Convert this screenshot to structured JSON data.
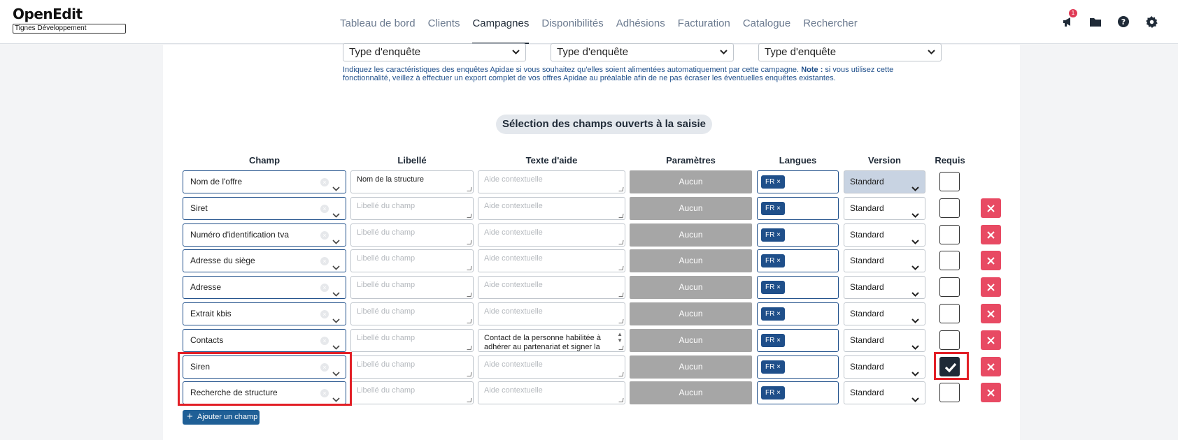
{
  "app": {
    "logo": "OpenEdit",
    "organization": "Tignes Développement"
  },
  "nav": {
    "items": [
      {
        "label": "Tableau de bord",
        "active": false
      },
      {
        "label": "Clients",
        "active": false
      },
      {
        "label": "Campagnes",
        "active": true
      },
      {
        "label": "Disponibilités",
        "active": false
      },
      {
        "label": "Adhésions",
        "active": false
      },
      {
        "label": "Facturation",
        "active": false
      },
      {
        "label": "Catalogue",
        "active": false
      },
      {
        "label": "Rechercher",
        "active": false
      }
    ],
    "notification_count": "1",
    "icons": [
      "megaphone-icon",
      "folder-icon",
      "help-icon",
      "settings-icon"
    ]
  },
  "enquetes": {
    "selects": [
      "Type d'enquête",
      "Type d'enquête",
      "Type d'enquête"
    ],
    "help_text": "Indiquez les caractéristiques des enquêtes Apidae si vous souhaitez qu'elles soient alimentées automatiquement par cette campagne.",
    "note_label": "Note :",
    "note_text": "si vous utilisez cette fonctionnalité, veillez à effectuer un export complet de vos offres Apidae au préalable afin de ne pas écraser les éventuelles enquêtes existantes."
  },
  "section": {
    "title": "Sélection des champs ouverts à la saisie"
  },
  "table": {
    "headers": {
      "champ": "Champ",
      "libelle": "Libellé",
      "aide": "Texte d'aide",
      "params": "Paramètres",
      "langues": "Langues",
      "version": "Version",
      "requis": "Requis"
    },
    "libelle_placeholder": "Libellé du champ",
    "aide_placeholder": "Aide contextuelle",
    "params_label": "Aucun",
    "lang_tag": "FR",
    "version_value": "Standard",
    "rows": [
      {
        "champ": "Nom de l'offre",
        "libelle": "Nom de la structure",
        "aide": "",
        "required": false,
        "deletable": false
      },
      {
        "champ": "Siret",
        "libelle": "",
        "aide": "",
        "required": false,
        "deletable": true
      },
      {
        "champ": "Numéro d'identification tva",
        "libelle": "",
        "aide": "",
        "required": false,
        "deletable": true
      },
      {
        "champ": "Adresse du siège",
        "libelle": "",
        "aide": "",
        "required": false,
        "deletable": true
      },
      {
        "champ": "Adresse",
        "libelle": "",
        "aide": "",
        "required": false,
        "deletable": true
      },
      {
        "champ": "Extrait kbis",
        "libelle": "",
        "aide": "",
        "required": false,
        "deletable": true
      },
      {
        "champ": "Contacts",
        "libelle": "",
        "aide": "Contact de la personne habilitée à adhérer au partenariat et signer la",
        "required": false,
        "deletable": true
      },
      {
        "champ": "Siren",
        "libelle": "",
        "aide": "",
        "required": true,
        "deletable": true
      },
      {
        "champ": "Recherche de structure",
        "libelle": "",
        "aide": "",
        "required": false,
        "deletable": true
      }
    ]
  },
  "actions": {
    "add_field": "Ajouter un champ"
  },
  "colors": {
    "accent": "#1f4f8a",
    "danger": "#e84a63",
    "highlight": "#e21f26",
    "disabled": "#a6a6a6"
  }
}
